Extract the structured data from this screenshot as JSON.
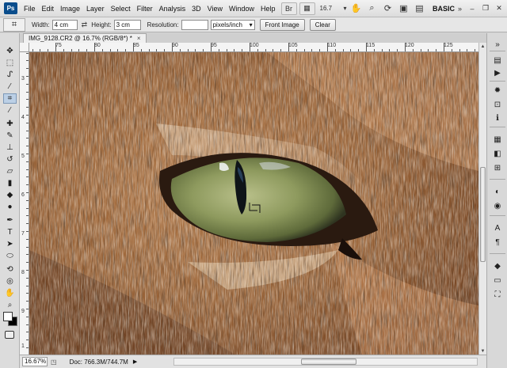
{
  "app": {
    "logo": "Ps"
  },
  "menubar": {
    "items": [
      "File",
      "Edit",
      "Image",
      "Layer",
      "Select",
      "Filter",
      "Analysis",
      "3D",
      "View",
      "Window",
      "Help"
    ],
    "zoom": "16.7",
    "workspace": "BASIC"
  },
  "options": {
    "width_label": "Width:",
    "width_value": "4 cm",
    "height_label": "Height:",
    "height_value": "3 cm",
    "resolution_label": "Resolution:",
    "resolution_value": "",
    "unit": "pixels/inch",
    "front_image_label": "Front Image",
    "clear_label": "Clear"
  },
  "document": {
    "tab_title": "IMG_9128.CR2 @ 16.7% (RGB/8*) *",
    "close_glyph": "×"
  },
  "ruler": {
    "top_labels": [
      "75",
      "80",
      "85",
      "90",
      "95",
      "100",
      "105",
      "110",
      "115",
      "120",
      "125"
    ],
    "left_labels": [
      "3",
      "4",
      "5",
      "6",
      "7",
      "8",
      "9",
      "1"
    ]
  },
  "statusbar": {
    "zoom": "16.67%",
    "doc_size": "Doc: 766.3M/744.7M"
  },
  "colors": {
    "foreground": "#ffffff",
    "background": "#000000"
  }
}
